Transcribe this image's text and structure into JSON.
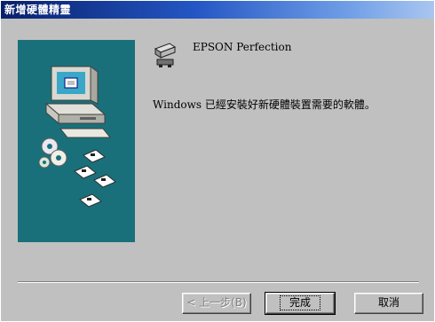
{
  "window": {
    "title": "新增硬體精靈"
  },
  "product": {
    "name": "EPSON Perfection",
    "icon": "scanner-icon"
  },
  "message": "Windows 已經安裝好新硬體裝置需要的軟體。",
  "illustration": {
    "icon": "computer-with-discs-illustration",
    "background_color": "#19707a"
  },
  "buttons": {
    "back": "< 上一步(B)",
    "finish": "完成",
    "cancel": "取消"
  }
}
